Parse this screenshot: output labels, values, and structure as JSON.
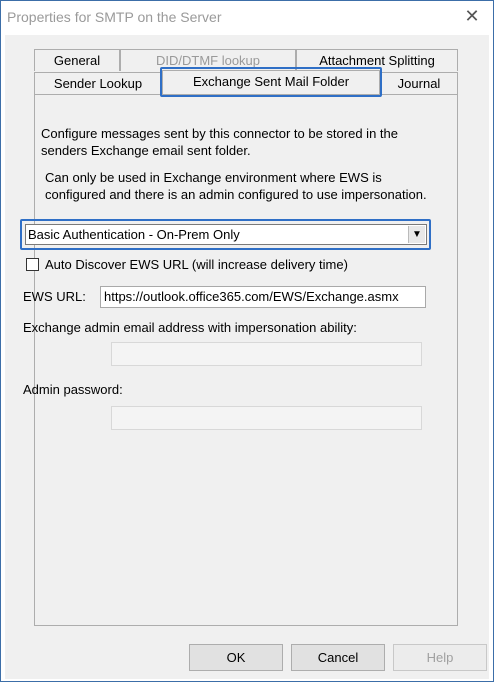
{
  "window": {
    "title": "Properties for SMTP on the Server",
    "close_glyph": "✕"
  },
  "tabs": {
    "row1": [
      {
        "label": "General",
        "disabled": false
      },
      {
        "label": "DID/DTMF lookup",
        "disabled": true
      },
      {
        "label": "Attachment Splitting",
        "disabled": false
      }
    ],
    "row2": [
      {
        "label": "Sender Lookup",
        "disabled": false
      },
      {
        "label": "Exchange Sent Mail Folder",
        "disabled": false,
        "active": true
      },
      {
        "label": "Journal",
        "disabled": false
      }
    ]
  },
  "panel": {
    "desc_line1": "Configure messages sent by this connector to be stored in the",
    "desc_line2": "senders Exchange email sent folder.",
    "note_line1": "Can only be used in Exchange environment where EWS is",
    "note_line2": "configured and there is an admin configured to use impersonation.",
    "auth_select": {
      "value": "Basic Authentication - On-Prem Only",
      "arrow_glyph": "▼"
    },
    "autodiscover": {
      "label": "Auto Discover EWS URL (will increase delivery time)",
      "checked": false
    },
    "ews_url": {
      "label": "EWS URL:",
      "value": "https://outlook.office365.com/EWS/Exchange.asmx"
    },
    "admin_email": {
      "label": "Exchange admin email address with impersonation ability:",
      "value": ""
    },
    "admin_password": {
      "label": "Admin password:",
      "value": ""
    }
  },
  "buttons": {
    "ok": "OK",
    "cancel": "Cancel",
    "help": "Help"
  },
  "colors": {
    "highlight": "#2f6fc6",
    "dialog_bg": "#f0f0f0",
    "disabled_text": "#9a9a9a"
  }
}
